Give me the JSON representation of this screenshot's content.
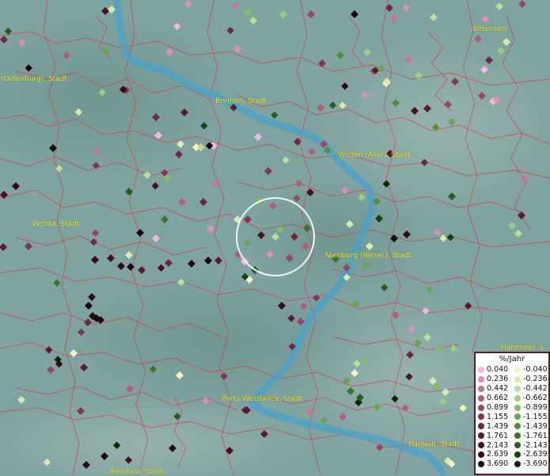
{
  "place_labels": [
    {
      "text": "Sittensen"
    },
    {
      "text": "(Oldenburg), Stadt"
    },
    {
      "text": "Bremen, Stadt"
    },
    {
      "text": "Verden (Aller), Stadt"
    },
    {
      "text": "Vechta, Stadt"
    },
    {
      "text": "Nienburg (Weser), Stadt"
    },
    {
      "text": "Hannover, L"
    },
    {
      "text": "Porta Westfalica, Stadt"
    },
    {
      "text": "Hameln, Stadt"
    },
    {
      "text": "Bielefeld, Stadt"
    }
  ],
  "legend": {
    "title": "%/Jahr",
    "positive": [
      {
        "value": "0.040",
        "color": "#f4b6e4"
      },
      {
        "value": "0.236",
        "color": "#dc8fbb"
      },
      {
        "value": "0.442",
        "color": "#c77499"
      },
      {
        "value": "0.662",
        "color": "#b15c7d"
      },
      {
        "value": "0.899",
        "color": "#9a4564"
      },
      {
        "value": "1.155",
        "color": "#843553"
      },
      {
        "value": "1.439",
        "color": "#6e2742"
      },
      {
        "value": "1.761",
        "color": "#591a31"
      },
      {
        "value": "2.143",
        "color": "#451022"
      },
      {
        "value": "2.639",
        "color": "#300815"
      },
      {
        "value": "3.690",
        "color": "#1c0209"
      }
    ],
    "negative": [
      {
        "value": "-0.040",
        "color": "#f3f6c4"
      },
      {
        "value": "-0.236",
        "color": "#d7ecb0"
      },
      {
        "value": "-0.442",
        "color": "#bcde98"
      },
      {
        "value": "-0.662",
        "color": "#9fcd7f"
      },
      {
        "value": "-0.899",
        "color": "#83bb66"
      },
      {
        "value": "-1.155",
        "color": "#67a54e"
      },
      {
        "value": "-1.439",
        "color": "#4f8e3b"
      },
      {
        "value": "-1.761",
        "color": "#3a752b"
      },
      {
        "value": "-2.143",
        "color": "#285c1e"
      },
      {
        "value": "-2.639",
        "color": "#184112"
      },
      {
        "value": "-3.690",
        "color": "#0a2707"
      }
    ]
  },
  "colors": {
    "background": "#7fa3a0",
    "river": "#4aa2c7",
    "boundaries": "#d8363c",
    "label_text": "#f2ee2a",
    "highlight_circle": "#f4f4f4"
  }
}
